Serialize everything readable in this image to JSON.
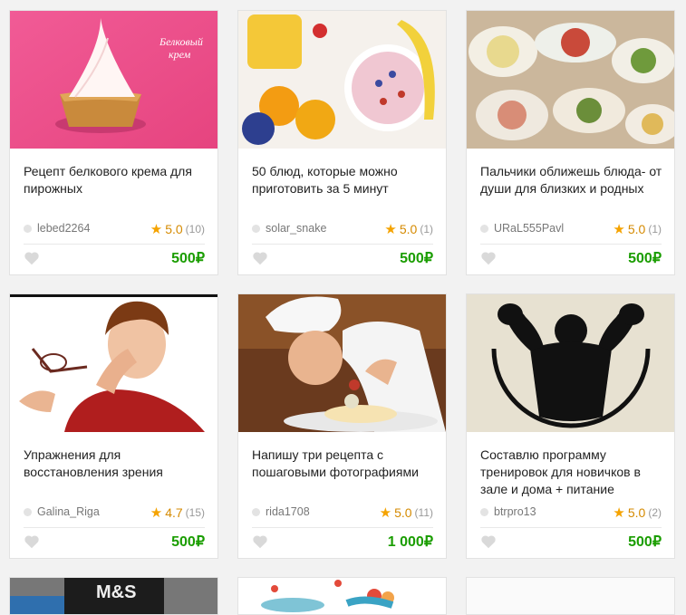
{
  "cards": [
    {
      "title": "Рецепт белкового крема для пирожных",
      "author": "lebed2264",
      "rating": "5.0",
      "count": "(10)",
      "price": "500₽",
      "image_text": "Белковый\nкрем"
    },
    {
      "title": "50 блюд, которые можно приготовить за 5 минут",
      "author": "solar_snake",
      "rating": "5.0",
      "count": "(1)",
      "price": "500₽"
    },
    {
      "title": "Пальчики оближешь блюда- от души для близких и родных",
      "author": "URaL555Pavl",
      "rating": "5.0",
      "count": "(1)",
      "price": "500₽"
    },
    {
      "title": "Упражнения для восстановления зрения",
      "author": "Galina_Riga",
      "rating": "4.7",
      "count": "(15)",
      "price": "500₽"
    },
    {
      "title": "Напишу три рецепта с пошаговыми фотографиями",
      "author": "rida1708",
      "rating": "5.0",
      "count": "(11)",
      "price": "1 000₽"
    },
    {
      "title": "Составлю программу тренировок для новичков в зале и дома + питание",
      "author": "btrpro13",
      "rating": "5.0",
      "count": "(2)",
      "price": "500₽"
    }
  ],
  "partial_card_text": "M&S",
  "icons": {
    "star": "star-icon",
    "heart": "heart-icon",
    "dot": "avatar-dot"
  },
  "colors": {
    "price": "#1a9d00",
    "star": "#f5a300",
    "background": "#f2f2f2"
  }
}
